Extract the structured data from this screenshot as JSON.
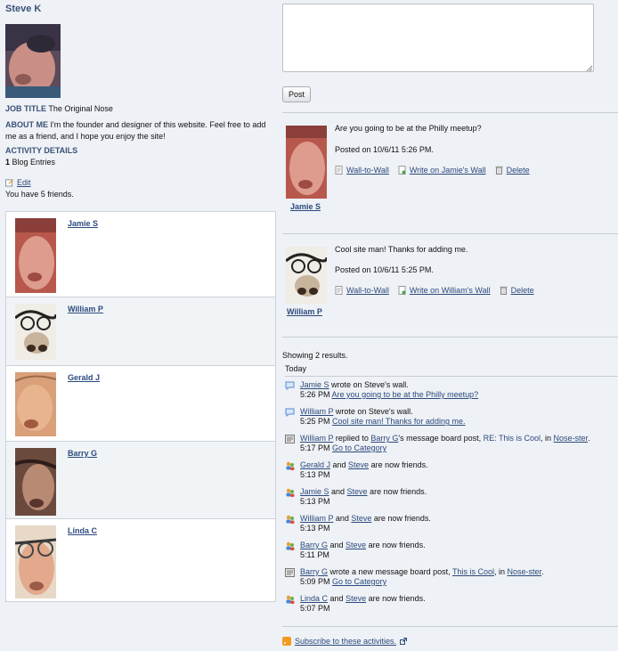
{
  "profile": {
    "name": "Steve K",
    "job_title_label": "JOB TITLE",
    "job_title": "The Original Nose",
    "about_label": "ABOUT ME",
    "about": "I'm the founder and designer of this website. Feel free to add me as a friend, and I hope you enjoy the site!",
    "activity_label": "ACTIVITY DETAILS",
    "blog_count": "1",
    "blog_label": "Blog Entries",
    "edit_label": "Edit",
    "friends_count_text": "You have 5 friends."
  },
  "friends": [
    {
      "name": "Jamie S"
    },
    {
      "name": "William P"
    },
    {
      "name": "Gerald J"
    },
    {
      "name": "Barry G"
    },
    {
      "name": "Linda C"
    }
  ],
  "wall": {
    "input_placeholder": "",
    "post_label": "Post",
    "posts": [
      {
        "author": "Jamie S",
        "message": "Are you going to be at the Philly meetup?",
        "posted": "Posted on 10/6/11 5:26 PM.",
        "wall_to_wall": "Wall-to-Wall",
        "write_on": "Write on Jamie's Wall",
        "delete": "Delete"
      },
      {
        "author": "William P",
        "message": "Cool site man! Thanks for adding me.",
        "posted": "Posted on 10/6/11 5:25 PM.",
        "wall_to_wall": "Wall-to-Wall",
        "write_on": "Write on William's Wall",
        "delete": "Delete"
      }
    ]
  },
  "activities": {
    "showing": "Showing 2 results.",
    "day": "Today",
    "subscribe": "Subscribe to these activities.",
    "items": [
      {
        "icon": "speech-bubble-icon",
        "user": "Jamie S",
        "text1": " wrote on Steve's wall.",
        "time": "5:26 PM",
        "link": "Are you going to be at the Philly meetup?"
      },
      {
        "icon": "speech-bubble-icon",
        "user": "William P",
        "text1": " wrote on Steve's wall.",
        "time": "5:25 PM",
        "link": "Cool site man! Thanks for adding me."
      },
      {
        "icon": "message-board-icon",
        "user": "William P",
        "text1": " replied to ",
        "user2": "Barry G",
        "text2": "'s message board post, ",
        "post": "RE: This is Cool",
        "text3": ", in ",
        "category": "Nose-ster",
        "text4": ".",
        "time": "5:17 PM",
        "link": "Go to Category"
      },
      {
        "icon": "friends-icon",
        "user": "Gerald J",
        "text1": " and ",
        "user2": "Steve",
        "text2": " are now friends.",
        "time": "5:13 PM"
      },
      {
        "icon": "friends-icon",
        "user": "Jamie S",
        "text1": " and ",
        "user2": "Steve",
        "text2": " are now friends.",
        "time": "5:13 PM"
      },
      {
        "icon": "friends-icon",
        "user": "William P",
        "text1": " and ",
        "user2": "Steve",
        "text2": " are now friends.",
        "time": "5:13 PM"
      },
      {
        "icon": "friends-icon",
        "user": "Barry G",
        "text1": " and ",
        "user2": "Steve",
        "text2": " are now friends.",
        "time": "5:11 PM"
      },
      {
        "icon": "message-board-icon",
        "user": "Barry G",
        "text1": " wrote a new message board post, ",
        "user2": "This is Cool",
        "text2": ", in ",
        "category": "Nose-ster",
        "text4": ".",
        "time": "5:09 PM",
        "link": "Go to Category"
      },
      {
        "icon": "friends-icon",
        "user": "Linda C",
        "text1": " and ",
        "user2": "Steve",
        "text2": " are now friends.",
        "time": "5:07 PM"
      }
    ]
  }
}
